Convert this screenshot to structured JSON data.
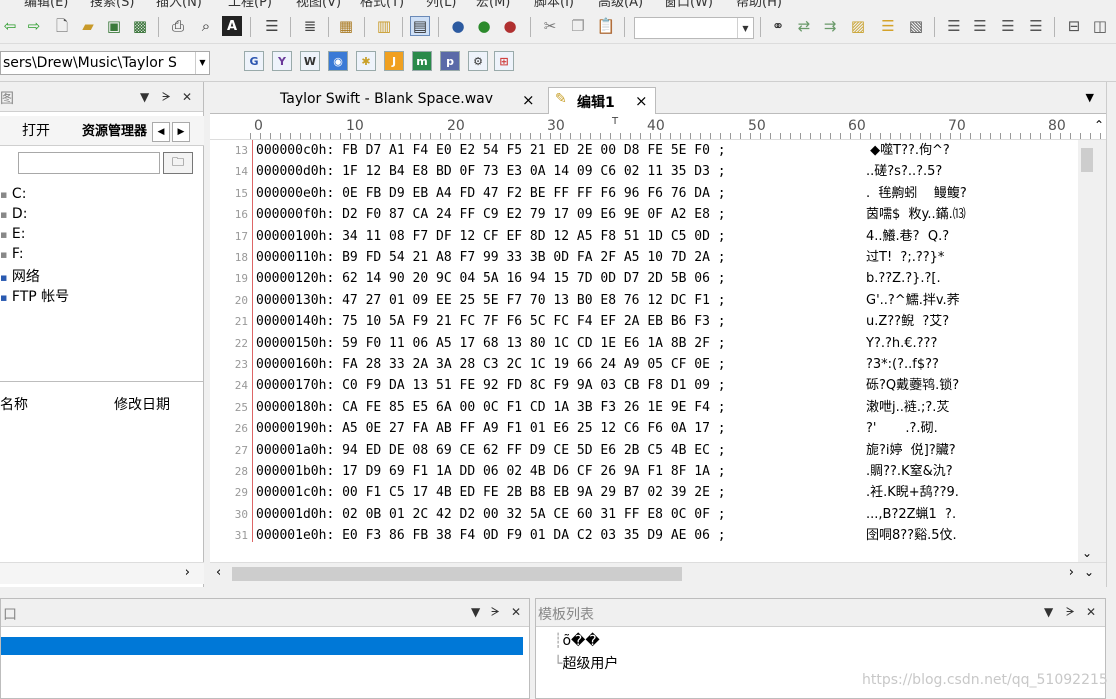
{
  "menubar": {
    "items": [
      "编辑(E)",
      "搜索(S)",
      "插入(N)",
      "工程(P)",
      "视图(V)",
      "格式(T)",
      "列(L)",
      "宏(M)",
      "脚本(I)",
      "高级(A)",
      "窗口(W)",
      "帮助(H)"
    ]
  },
  "toolbar": {
    "combo_value": "",
    "icons": [
      "back-icon",
      "forward-icon",
      "new-file-icon",
      "open-folder-icon",
      "open-icon",
      "save-icon",
      "print-icon",
      "print-preview-icon",
      "font-icon",
      "page-icon",
      "wordwrap-icon",
      "toolbox-icon",
      "columns-icon",
      "hex-toggle-icon",
      "record-macro-icon",
      "play-macro-icon",
      "stop-macro-icon",
      "cut-icon",
      "copy-icon",
      "paste-icon",
      "binoculars-icon",
      "replace-icon",
      "replace-all-icon",
      "find-in-files-icon",
      "list-icon",
      "db-icon",
      "align-left-icon",
      "align-center-icon",
      "align-right-icon",
      "justify-icon",
      "split-h-icon",
      "split-v-icon"
    ]
  },
  "path": {
    "value": "sers\\Drew\\Music\\Taylor S"
  },
  "left_panel": {
    "title": "图",
    "tabs": [
      "打开",
      "资源管理器"
    ],
    "tree": [
      "C:",
      "D:",
      "E:",
      "F:",
      "网络",
      "FTP 帐号"
    ],
    "columns": [
      "名称",
      "修改日期"
    ]
  },
  "editor": {
    "tabs": [
      {
        "label": "Taylor Swift - Blank Space.wav",
        "close": "×"
      },
      {
        "label": "编辑1",
        "close": "×"
      }
    ],
    "ruler": [
      "0",
      "10",
      "20",
      "30",
      "40",
      "50",
      "60",
      "70",
      "80"
    ],
    "rows": [
      {
        "ln": "13",
        "hex": "000000c0h: FB D7 A1 F4 E0 E2 54 F5 21 ED 2E 00 D8 FE 5E F0 ;",
        "ascii": " ◆噬T??.佝^?"
      },
      {
        "ln": "14",
        "hex": "000000d0h: 1F 12 B4 E8 BD 0F 73 E3 0A 14 09 C6 02 11 35 D3 ;",
        "ascii": "..磋?s?..?.5?"
      },
      {
        "ln": "15",
        "hex": "000000e0h: 0E FB D9 EB A4 FD 47 F2 BE FF FF F6 96 F6 76 DA ;",
        "ascii": ".  毪齁蚓    鳗鳆?"
      },
      {
        "ln": "16",
        "hex": "000000f0h: D2 F0 87 CA 24 FF C9 E2 79 17 09 E6 9E 0F A2 E8 ;",
        "ascii": "茵嚅$  敉y..鏋.⒀"
      },
      {
        "ln": "17",
        "hex": "00000100h: 34 11 08 F7 DF 12 CF EF 8D 12 A5 F8 51 1D C5 0D ;",
        "ascii": "4..鱶.巷?  Q.?"
      },
      {
        "ln": "18",
        "hex": "00000110h: B9 FD 54 21 A8 F7 99 33 3B 0D FA 2F A5 10 7D 2A ;",
        "ascii": "过T!  ?;.??}*"
      },
      {
        "ln": "19",
        "hex": "00000120h: 62 14 90 20 9C 04 5A 16 94 15 7D 0D D7 2D 5B 06 ;",
        "ascii": "b.??Z.?}.?[."
      },
      {
        "ln": "20",
        "hex": "00000130h: 47 27 01 09 EE 25 5E F7 70 13 B0 E8 76 12 DC F1 ;",
        "ascii": "G'..?^鱬.拌v.荞"
      },
      {
        "ln": "21",
        "hex": "00000140h: 75 10 5A F9 21 FC 7F F6 5C FC F4 EF 2A EB B6 F3 ;",
        "ascii": "u.Z??鲵  ?艾?"
      },
      {
        "ln": "22",
        "hex": "00000150h: 59 F0 11 06 A5 17 68 13 80 1C CD 1E E6 1A 8B 2F ;",
        "ascii": "Y?.?h.€.???"
      },
      {
        "ln": "23",
        "hex": "00000160h: FA 28 33 2A 3A 28 C3 2C 1C 19 66 24 A9 05 CF 0E ;",
        "ascii": "?3*:(?..f$??"
      },
      {
        "ln": "24",
        "hex": "00000170h: C0 F9 DA 13 51 FE 92 FD 8C F9 9A 03 CB F8 D1 09 ;",
        "ascii": "砾?Q戴虁鸨.锁?"
      },
      {
        "ln": "25",
        "hex": "00000180h: CA FE 85 E5 6A 00 0C F1 CD 1A 3B F3 26 1E 9E F4 ;",
        "ascii": "潄呭j..裢.;?.炗"
      },
      {
        "ln": "26",
        "hex": "00000190h: A5 0E 27 FA AB FF A9 F1 01 E6 25 12 C6 F6 0A 17 ;",
        "ascii": "?'       .?.砌."
      },
      {
        "ln": "27",
        "hex": "000001a0h: 94 ED DE 08 69 CE 62 FF D9 CE 5D E6 2B C5 4B EC ;",
        "ascii": "旎?i婷  侻]?贜?"
      },
      {
        "ln": "28",
        "hex": "000001b0h: 17 D9 69 F1 1A DD 06 02 4B D6 CF 26 9A F1 8F 1A ;",
        "ascii": ".賙??.K窒&氿?"
      },
      {
        "ln": "29",
        "hex": "000001c0h: 00 F1 C5 17 4B ED FE 2B B8 EB 9A 29 B7 02 39 2E ;",
        "ascii": ".衽.K睨+鸹??9."
      },
      {
        "ln": "30",
        "hex": "000001d0h: 02 0B 01 2C 42 D2 00 32 5A CE 60 31 FF E8 0C 0F ;",
        "ascii": "...,B?2Z蝋1  ?."
      },
      {
        "ln": "31",
        "hex": "000001e0h: E0 F3 86 FB 38 F4 0D F9 01 DA C2 03 35 D9 AE 06 ;",
        "ascii": "囹哃8??谿.5伩."
      }
    ]
  },
  "bottom_left": {
    "title": "口"
  },
  "bottom_right": {
    "title": "模板列表",
    "items": [
      "õ��",
      "超级用户"
    ]
  },
  "watermark": "https://blog.csdn.net/qq_51092215",
  "colors": {
    "accent": "#0078d7",
    "gutter_line": "#d66666",
    "panel_bg": "#f0f0f0"
  }
}
